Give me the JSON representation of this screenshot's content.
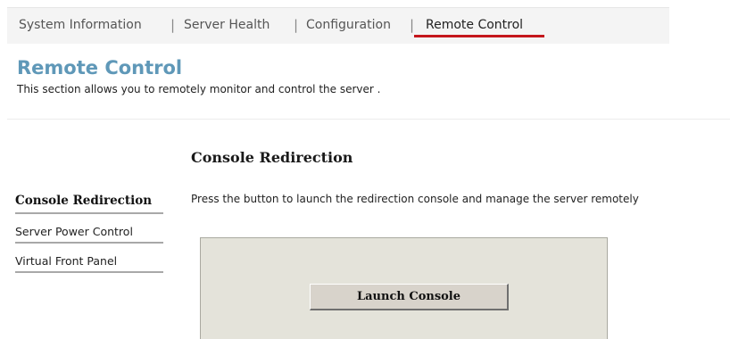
{
  "tabs": [
    {
      "label": "System Information",
      "active": false
    },
    {
      "label": "Server Health",
      "active": false
    },
    {
      "label": "Configuration",
      "active": false
    },
    {
      "label": "Remote Control",
      "active": true
    }
  ],
  "header": {
    "title": "Remote Control",
    "description": "This section allows you to remotely monitor and control the server ."
  },
  "section": {
    "title": "Console Redirection",
    "instruction": "Press the button to launch the redirection console and manage the server remotely"
  },
  "sidebar": {
    "items": [
      {
        "label": "Console Redirection",
        "active": true
      },
      {
        "label": "Server Power Control",
        "active": false
      },
      {
        "label": "Virtual Front Panel",
        "active": false
      }
    ]
  },
  "panel": {
    "launch_button_label": "Launch Console"
  },
  "colors": {
    "title": "#5f98b8",
    "active_tab_underline": "#c4161c",
    "panel_background": "#e4e3da",
    "button_background": "#d8d3cb"
  }
}
